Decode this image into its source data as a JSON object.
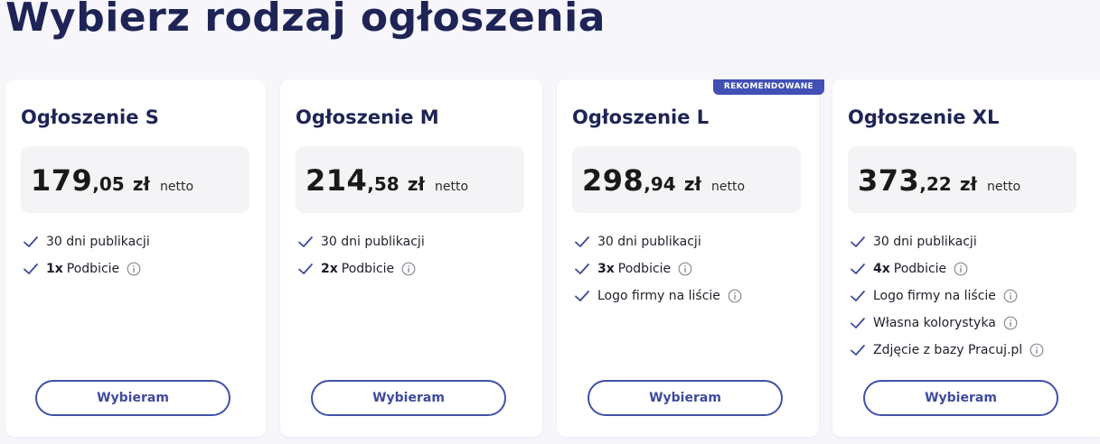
{
  "page": {
    "title": "Wybierz rodzaj ogłoszenia"
  },
  "colors": {
    "accent": "#4150b4",
    "title": "#1f2456",
    "background": "#f6f6fb",
    "card": "#ffffff",
    "price_box": "#f4f4f6"
  },
  "icons": {
    "feature": "check-icon",
    "info": "info-icon"
  },
  "plans": [
    {
      "name": "Ogłoszenie S",
      "badge": "",
      "price_int": "179",
      "price_dec": ",05",
      "currency": "zł",
      "net_label": "netto",
      "features": [
        {
          "bold": "",
          "text": "30 dni publikacji",
          "info": false
        },
        {
          "bold": "1x",
          "text": "Podbicie",
          "info": true
        }
      ],
      "button": "Wybieram"
    },
    {
      "name": "Ogłoszenie M",
      "badge": "",
      "price_int": "214",
      "price_dec": ",58",
      "currency": "zł",
      "net_label": "netto",
      "features": [
        {
          "bold": "",
          "text": "30 dni publikacji",
          "info": false
        },
        {
          "bold": "2x",
          "text": "Podbicie",
          "info": true
        }
      ],
      "button": "Wybieram"
    },
    {
      "name": "Ogłoszenie L",
      "badge": "REKOMENDOWANE",
      "price_int": "298",
      "price_dec": ",94",
      "currency": "zł",
      "net_label": "netto",
      "features": [
        {
          "bold": "",
          "text": "30 dni publikacji",
          "info": false
        },
        {
          "bold": "3x",
          "text": "Podbicie",
          "info": true
        },
        {
          "bold": "",
          "text": "Logo firmy na liście",
          "info": true
        }
      ],
      "button": "Wybieram"
    },
    {
      "name": "Ogłoszenie XL",
      "badge": "",
      "price_int": "373",
      "price_dec": ",22",
      "currency": "zł",
      "net_label": "netto",
      "features": [
        {
          "bold": "",
          "text": "30 dni publikacji",
          "info": false
        },
        {
          "bold": "4x",
          "text": "Podbicie",
          "info": true
        },
        {
          "bold": "",
          "text": "Logo firmy na liście",
          "info": true
        },
        {
          "bold": "",
          "text": "Własna kolorystyka",
          "info": true
        },
        {
          "bold": "",
          "text": "Zdjęcie z bazy Pracuj.pl",
          "info": true
        }
      ],
      "button": "Wybieram"
    }
  ]
}
